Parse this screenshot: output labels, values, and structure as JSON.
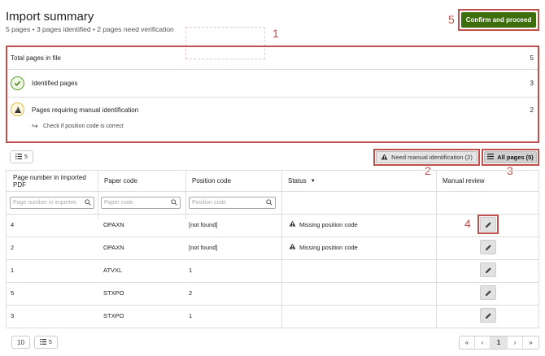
{
  "header": {
    "title": "Import summary",
    "subtitle": "5 pages • 3 pages identified • 2 pages need verification",
    "confirm_label": "Confirm and proceed"
  },
  "annotations": {
    "n1": "1",
    "n2": "2",
    "n3": "3",
    "n4": "4",
    "n5": "5"
  },
  "summary": {
    "total_label": "Total pages in file",
    "total_value": "5",
    "identified_label": "Identified pages",
    "identified_value": "3",
    "manual_label": "Pages requiring manual identification",
    "manual_value": "2",
    "manual_hint": "Check if position code is correct"
  },
  "toolbar": {
    "columns_count": "5",
    "need_manual_label": "Need manual identification (2)",
    "all_pages_label": "All pages (5)"
  },
  "table": {
    "headers": {
      "page": "Page number in imported PDF",
      "paper": "Paper code",
      "position": "Position code",
      "status": "Status",
      "review": "Manual review"
    },
    "filters": {
      "page_placeholder": "Page number in importec",
      "paper_placeholder": "Paper code",
      "position_placeholder": "Position code"
    },
    "rows": [
      {
        "page": "4",
        "paper": "OPAXN",
        "position": "[not found]",
        "status": "Missing position code"
      },
      {
        "page": "2",
        "paper": "OPAXN",
        "position": "[not found]",
        "status": "Missing position code"
      },
      {
        "page": "1",
        "paper": "ATVXL",
        "position": "1",
        "status": ""
      },
      {
        "page": "5",
        "paper": "STXPO",
        "position": "2",
        "status": ""
      },
      {
        "page": "3",
        "paper": "STXPO",
        "position": "1",
        "status": ""
      }
    ]
  },
  "footer": {
    "page_size": "10",
    "columns_count": "5",
    "current_page": "1"
  },
  "colors": {
    "accent": "#3c6e0c",
    "annotation": "#c0504d"
  },
  "icons": [
    "check-icon",
    "warning-icon",
    "list-icon",
    "search-icon",
    "pencil-icon",
    "sort-down-icon",
    "return-arrow-icon"
  ]
}
